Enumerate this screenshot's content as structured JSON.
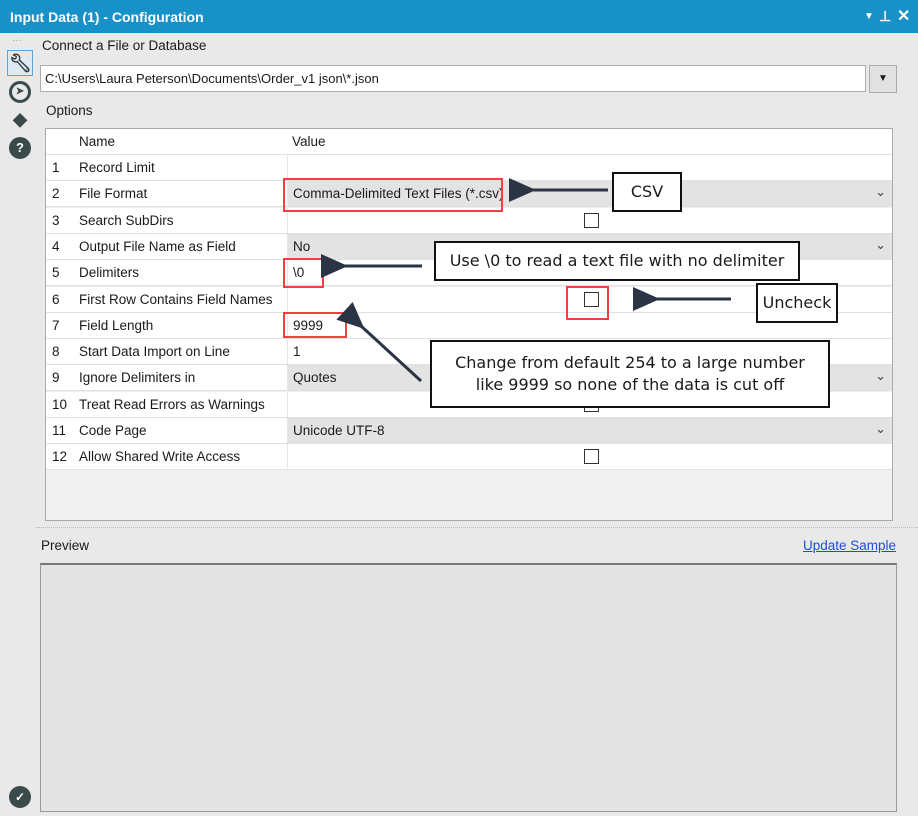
{
  "window": {
    "title": "Input Data (1) - Configuration",
    "controls": [
      "dropdown-icon",
      "pin-icon",
      "close-icon"
    ]
  },
  "sidebar": {
    "icons": [
      "wrench-icon",
      "navigation-icon",
      "tag-icon",
      "help-icon"
    ],
    "status_icon": "check-circle-icon"
  },
  "connect": {
    "label": "Connect a File or Database",
    "path": "C:\\Users\\Laura Peterson\\Documents\\Order_v1 json\\*.json"
  },
  "options": {
    "label": "Options",
    "headers": {
      "name": "Name",
      "value": "Value"
    },
    "rows": [
      {
        "num": "1",
        "name": "Record Limit",
        "value": "",
        "type": "text"
      },
      {
        "num": "2",
        "name": "File Format",
        "value": "Comma-Delimited Text Files (*.csv)",
        "type": "dropdown"
      },
      {
        "num": "3",
        "name": "Search SubDirs",
        "value": "",
        "type": "checkbox",
        "checked": false
      },
      {
        "num": "4",
        "name": "Output File Name as Field",
        "value": "No",
        "type": "dropdown"
      },
      {
        "num": "5",
        "name": "Delimiters",
        "value": "\\0",
        "type": "text"
      },
      {
        "num": "6",
        "name": "First Row Contains Field Names",
        "value": "",
        "type": "checkbox",
        "checked": false
      },
      {
        "num": "7",
        "name": "Field Length",
        "value": "9999",
        "type": "text"
      },
      {
        "num": "8",
        "name": "Start Data Import on Line",
        "value": "1",
        "type": "text"
      },
      {
        "num": "9",
        "name": "Ignore Delimiters in",
        "value": "Quotes",
        "type": "dropdown"
      },
      {
        "num": "10",
        "name": "Treat Read Errors as Warnings",
        "value": "",
        "type": "checkbox",
        "checked": false
      },
      {
        "num": "11",
        "name": "Code Page",
        "value": "Unicode UTF-8",
        "type": "dropdown"
      },
      {
        "num": "12",
        "name": "Allow Shared Write Access",
        "value": "",
        "type": "checkbox",
        "checked": false
      }
    ]
  },
  "annotations": {
    "csv": "CSV",
    "delimiter": "Use \\0 to read  a text file with no delimiter",
    "uncheck": "Uncheck",
    "field_length": "Change from default 254 to a large number like 9999 so none of the data is cut off"
  },
  "preview": {
    "label": "Preview",
    "update_link": "Update Sample"
  },
  "colors": {
    "titlebar": "#1891c9",
    "highlight": "#f04040",
    "link": "#1a50d8"
  }
}
